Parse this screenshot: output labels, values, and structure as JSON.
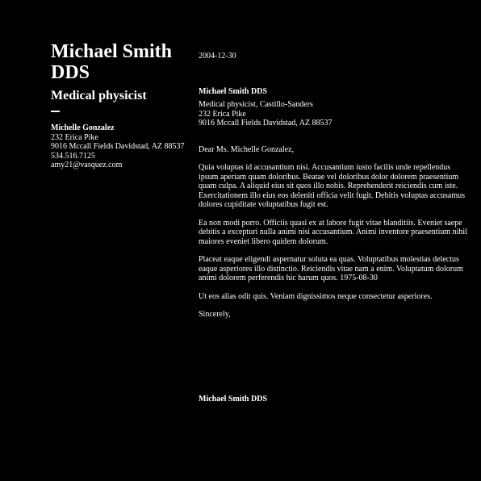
{
  "sender": {
    "name_line1": "Michael Smith",
    "name_line2": "DDS",
    "title": "Medical physicist"
  },
  "contact": {
    "name": "Michelle Gonzalez",
    "street": "232 Erica Pike",
    "city": "9016 Mccall Fields Davidstad, AZ 88537",
    "phone": "534.516.7125",
    "email": "amy21@vasquez.com"
  },
  "letter": {
    "date": "2004-12-30",
    "recipient_name": "Michael Smith DDS",
    "recipient_org": "Medical physicist, Castillo-Sanders",
    "recipient_street": "232 Erica Pike",
    "recipient_city": "9016 Mccall Fields Davidstad, AZ 88537",
    "salutation": "Dear Ms. Michelle Gonzalez,",
    "paragraphs": [
      "Quia voluptas id accusantium nisi. Accusantium iusto facilis unde repellendus ipsum aperiam quam doloribus. Beatae vel doloribus dolor dolorem praesentium quam culpa. A aliquid eius sit quos illo nobis. Reprehenderit reiciendis cum iste. Exercitationem illo eius eos deleniti officia velit fugit. Debitis voluptas accusamus dolores cupiditate voluptatibus fugit est.",
      "Ea non modi porro. Officiis quasi ex at labore fugit vitae blanditiis. Eveniet saepe debitis a excepturi nulla animi nisi accusantium. Animi inventore praesentium nihil maiores eveniet libero quidem dolorum.",
      "Placeat eaque eligendi aspernatur soluta ea quas. Voluptatibus molestias delectus eaque asperiores illo distinctio. Reiciendis vitae nam a enim. Voluptatum dolorum animi dolorem perferendis hic harum quos. 1975-08-30",
      "Ut eos alias odit quis. Veniam dignissimos neque consectetur asperiores."
    ],
    "closing": "Sincerely,",
    "signature": "Michael Smith DDS"
  }
}
